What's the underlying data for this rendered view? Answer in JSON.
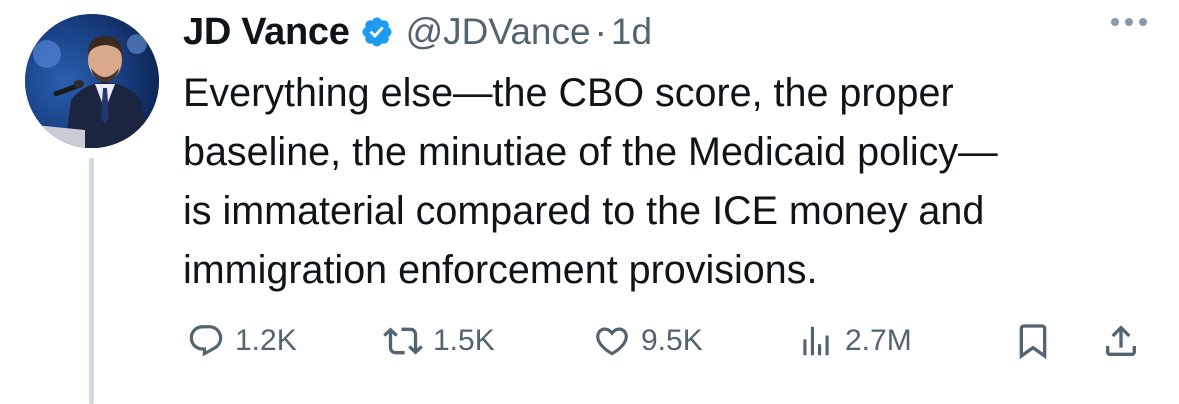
{
  "author": {
    "display_name": "JD Vance",
    "handle": "@JDVance",
    "separator": "·",
    "time": "1d",
    "verified": true,
    "verified_color": "#1d9bf0"
  },
  "tweet": {
    "lines": [
      "Everything else—the CBO score, the proper",
      "baseline, the minutiae of the Medicaid policy—",
      "is immaterial compared to the ICE money and",
      "immigration enforcement provisions."
    ]
  },
  "actions": {
    "reply": {
      "icon": "reply-icon",
      "count": "1.2K"
    },
    "retweet": {
      "icon": "retweet-icon",
      "count": "1.5K"
    },
    "like": {
      "icon": "heart-icon",
      "count": "9.5K"
    },
    "views": {
      "icon": "views-icon",
      "count": "2.7M"
    },
    "bookmark": {
      "icon": "bookmark-icon"
    },
    "share": {
      "icon": "share-icon"
    }
  },
  "colors": {
    "text": "#0f1419",
    "secondary": "#536471",
    "thread_line": "#cfd9de"
  }
}
